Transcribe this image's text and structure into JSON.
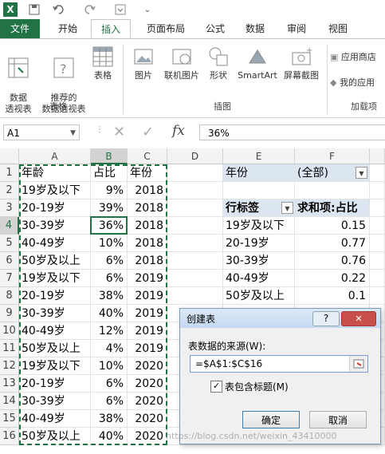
{
  "qat": {
    "excel_logo": "X",
    "save": "save-icon",
    "undo": "undo-icon",
    "redo": "redo-icon"
  },
  "tabs": [
    "文件",
    "开始",
    "插入",
    "页面布局",
    "公式",
    "数据",
    "审阅",
    "视图"
  ],
  "ribbon": {
    "pivot": "数据\n透视表",
    "rec_pivot": "推荐的\n数据透视表",
    "table": "表格",
    "group_tables": "表格",
    "picture": "图片",
    "online_picture": "联机图片",
    "shapes": "形状",
    "smartart": "SmartArt",
    "screenshot": "屏幕截图",
    "group_illustrations": "插图",
    "app_store": "应用商店",
    "my_apps": "我的应用",
    "group_addins": "加载项"
  },
  "formula": {
    "namebox": "A1",
    "cancel": "✕",
    "enter": "✓",
    "fx": "fx",
    "value": "36%"
  },
  "columns": [
    "A",
    "B",
    "C",
    "D",
    "E",
    "F"
  ],
  "rows": [
    [
      "年龄",
      "占比",
      "年份"
    ],
    [
      "19岁及以下",
      "9%",
      "2018"
    ],
    [
      "20-19岁",
      "39%",
      "2018"
    ],
    [
      "30-39岁",
      "36%",
      "2018"
    ],
    [
      "40-49岁",
      "10%",
      "2018"
    ],
    [
      "50岁及以上",
      "6%",
      "2018"
    ],
    [
      "19岁及以下",
      "6%",
      "2019"
    ],
    [
      "20-19岁",
      "38%",
      "2019"
    ],
    [
      "30-39岁",
      "40%",
      "2019"
    ],
    [
      "40-49岁",
      "12%",
      "2019"
    ],
    [
      "50岁及以上",
      "4%",
      "2019"
    ],
    [
      "19岁及以下",
      "10%",
      "2020"
    ],
    [
      "20-19岁",
      "6%",
      "2020"
    ],
    [
      "30-39岁",
      "6%",
      "2020"
    ],
    [
      "40-49岁",
      "38%",
      "2020"
    ],
    [
      "50岁及以上",
      "40%",
      "2020"
    ]
  ],
  "pivot": {
    "filter_label": "年份",
    "filter_value": "(全部)",
    "row_label": "行标签",
    "sum_label": "求和项:占比",
    "items": [
      {
        "label": "19岁及以下",
        "value": "0.15"
      },
      {
        "label": "20-19岁",
        "value": "0.77"
      },
      {
        "label": "30-39岁",
        "value": "0.76"
      },
      {
        "label": "40-49岁",
        "value": "0.22"
      },
      {
        "label": "50岁及以上",
        "value": "0.1"
      }
    ]
  },
  "dialog": {
    "title": "创建表",
    "help": "?",
    "close": "✕",
    "source_label": "表数据的来源(W):",
    "range": "=$A$1:$C$16",
    "header_checkbox": "表包含标题(M)",
    "ok": "确定",
    "cancel": "取消"
  },
  "watermark": "https://blog.csdn.net/weixin_43410000"
}
